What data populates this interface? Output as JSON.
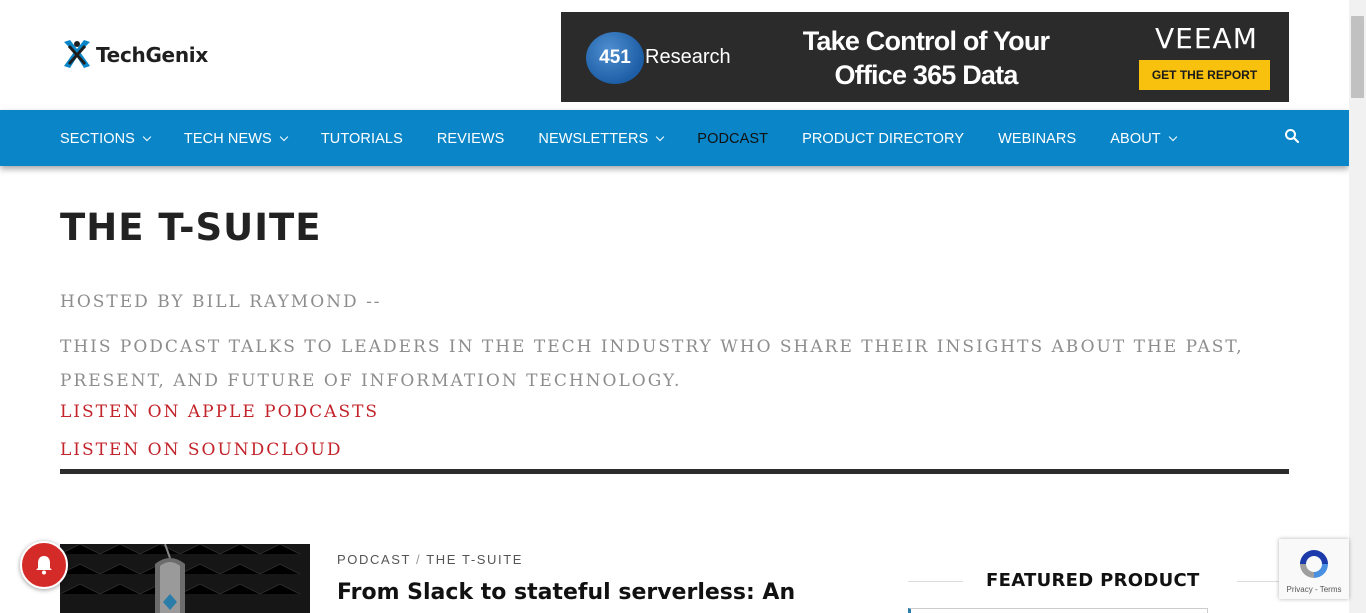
{
  "header": {
    "logo_text": "TechGenix"
  },
  "ad": {
    "badge": "451",
    "research": "Research",
    "headline": "Take Control of Your Office 365 Data",
    "brand": "VEEAM",
    "cta": "GET THE REPORT"
  },
  "nav": {
    "items": [
      {
        "label": "SECTIONS",
        "dropdown": true
      },
      {
        "label": "TECH NEWS",
        "dropdown": true
      },
      {
        "label": "TUTORIALS",
        "dropdown": false
      },
      {
        "label": "REVIEWS",
        "dropdown": false
      },
      {
        "label": "NEWSLETTERS",
        "dropdown": true
      },
      {
        "label": "PODCAST",
        "dropdown": false,
        "active": true
      },
      {
        "label": "PRODUCT DIRECTORY",
        "dropdown": false
      },
      {
        "label": "WEBINARS",
        "dropdown": false
      },
      {
        "label": "ABOUT",
        "dropdown": true
      }
    ],
    "search_icon": "search-icon"
  },
  "main": {
    "title": "THE T-SUITE",
    "host_line": "HOSTED BY BILL RAYMOND --",
    "description": "THIS PODCAST TALKS TO LEADERS IN THE TECH INDUSTRY WHO SHARE THEIR INSIGHTS ABOUT THE PAST, PRESENT, AND FUTURE OF INFORMATION TECHNOLOGY.",
    "link_apple": "LISTEN ON APPLE PODCASTS",
    "link_soundcloud": "LISTEN ON SOUNDCLOUD"
  },
  "article": {
    "category_1": "PODCAST",
    "separator": "/",
    "category_2": "THE T-SUITE",
    "title": "From Slack to stateful serverless: An"
  },
  "sidebar": {
    "featured_heading": "FEATURED PRODUCT"
  },
  "recaptcha": {
    "links": "Privacy - Terms"
  },
  "colors": {
    "nav_bg": "#0a85c7",
    "link_red": "#c3232a",
    "cta_yellow": "#f8c10e",
    "bell_red": "#d52b28"
  }
}
